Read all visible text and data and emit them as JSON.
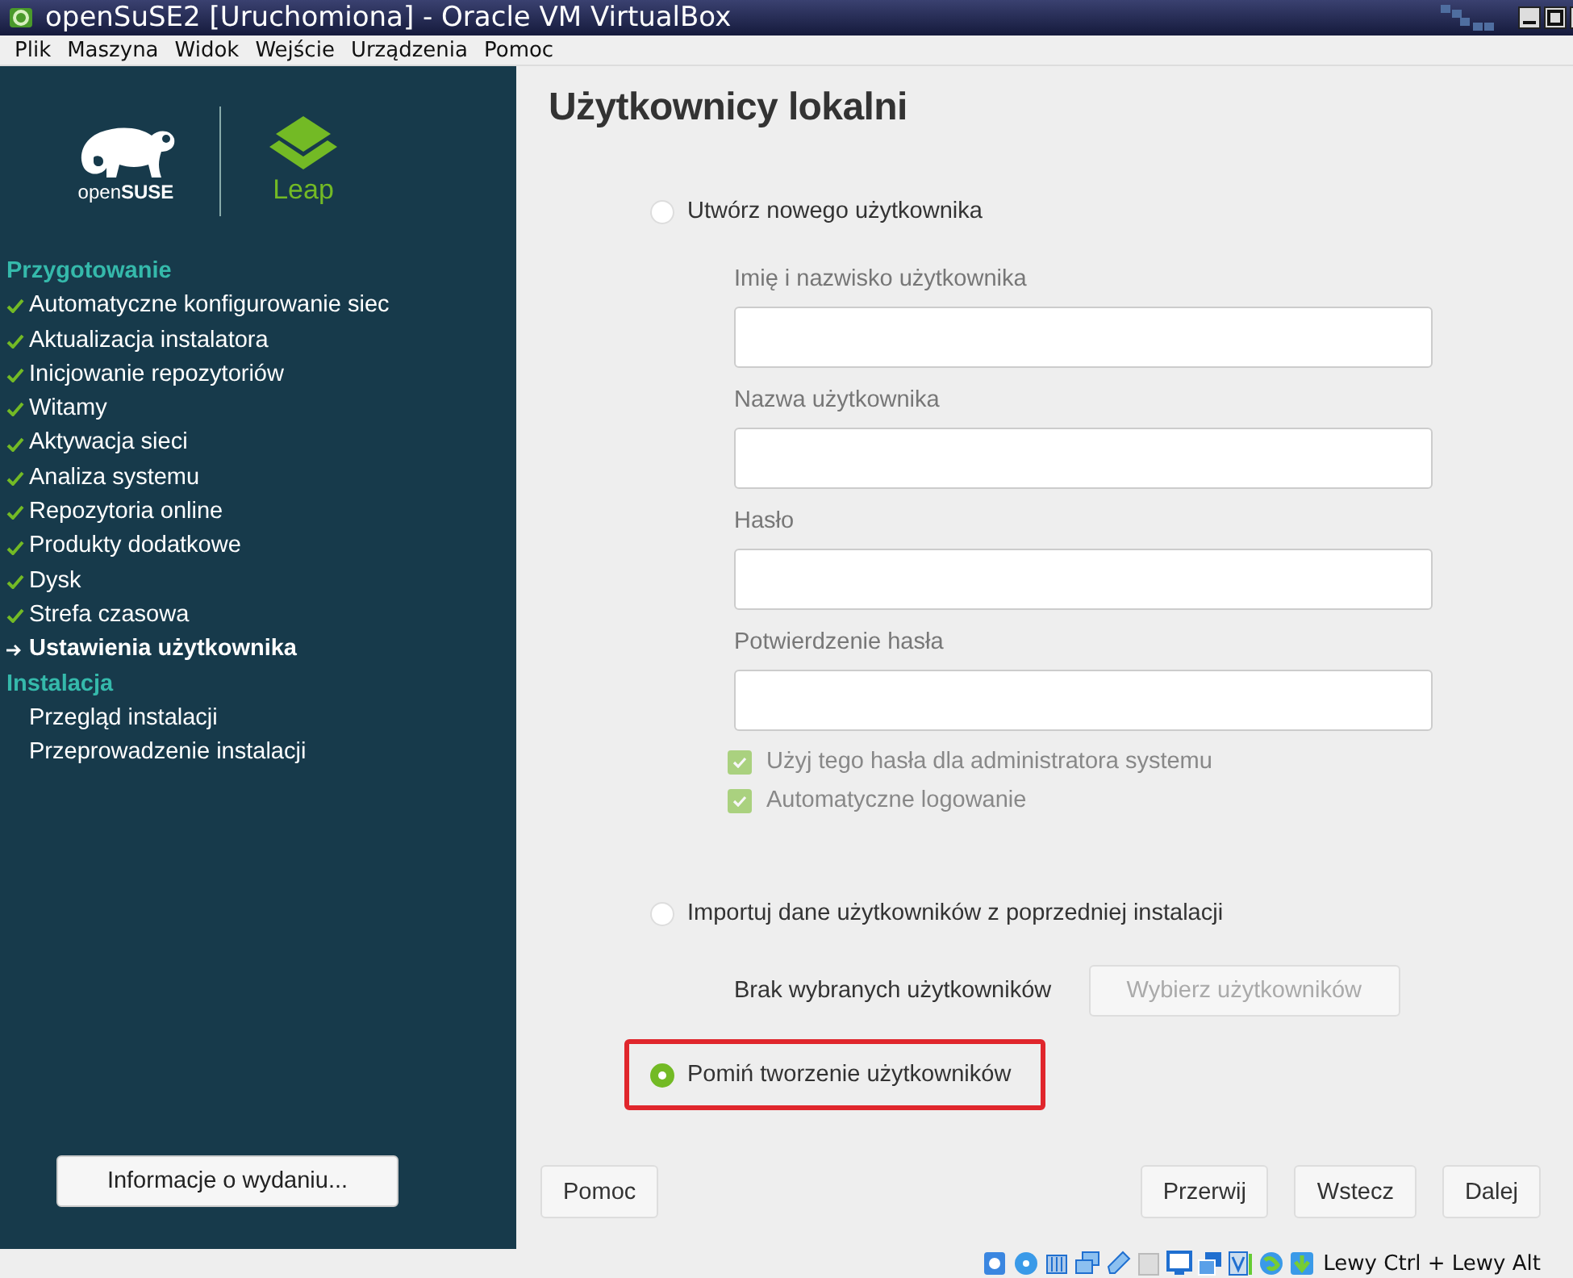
{
  "window": {
    "title": "openSuSE2 [Uruchomiona] - Oracle VM VirtualBox"
  },
  "menu": [
    "Plik",
    "Maszyna",
    "Widok",
    "Wejście",
    "Urządzenia",
    "Pomoc"
  ],
  "sidebar": {
    "logo": {
      "brand": "open**SUSE**",
      "product": "Leap"
    },
    "sections": [
      {
        "title": "Przygotowanie",
        "items": [
          {
            "label": "Automatyczne konfigurowanie siec",
            "kind": "done"
          },
          {
            "label": "Aktualizacja instalatora",
            "kind": "done"
          },
          {
            "label": "Inicjowanie repozytoriów",
            "kind": "done"
          },
          {
            "label": "Witamy",
            "kind": "done"
          },
          {
            "label": "Aktywacja sieci",
            "kind": "done"
          },
          {
            "label": "Analiza systemu",
            "kind": "done"
          },
          {
            "label": "Repozytoria online",
            "kind": "done"
          },
          {
            "label": "Produkty dodatkowe",
            "kind": "done"
          },
          {
            "label": "Dysk",
            "kind": "done"
          },
          {
            "label": "Strefa czasowa",
            "kind": "done"
          },
          {
            "label": "Ustawienia użytkownika",
            "kind": "current"
          }
        ]
      },
      {
        "title": "Instalacja",
        "items": [
          {
            "label": "Przegląd instalacji",
            "kind": "pending"
          },
          {
            "label": "Przeprowadzenie instalacji",
            "kind": "pending"
          }
        ]
      }
    ],
    "release_notes_button": "Informacje o wydaniu..."
  },
  "content": {
    "title": "Użytkownicy lokalni",
    "options": [
      {
        "label": "Utwórz nowego użytkownika",
        "selected": false,
        "highlighted": false,
        "fields": [
          {
            "label": "Imię i nazwisko użytkownika"
          },
          {
            "label": "Nazwa użytkownika"
          },
          {
            "label": "Hasło"
          },
          {
            "label": "Potwierdzenie hasła"
          }
        ],
        "checkboxes": [
          {
            "label": "Użyj tego hasła dla administratora systemu",
            "checked": true,
            "disabled": true
          },
          {
            "label": "Automatyczne logowanie",
            "checked": true,
            "disabled": true
          }
        ]
      },
      {
        "label": "Importuj dane użytkowników z poprzedniej instalacji",
        "selected": false,
        "highlighted": false,
        "note": "Brak wybranych użytkowników",
        "button": {
          "label": "Wybierz użytkowników",
          "disabled": true
        }
      },
      {
        "label": "Pomiń tworzenie użytkowników",
        "selected": true,
        "highlighted": true
      }
    ]
  },
  "buttons": {
    "left": [
      "Pomoc"
    ],
    "right": [
      "Przerwij",
      "Wstecz",
      "Dalej"
    ]
  },
  "status_bar": {
    "hotkey": "Lewy Ctrl + Lewy Alt"
  }
}
